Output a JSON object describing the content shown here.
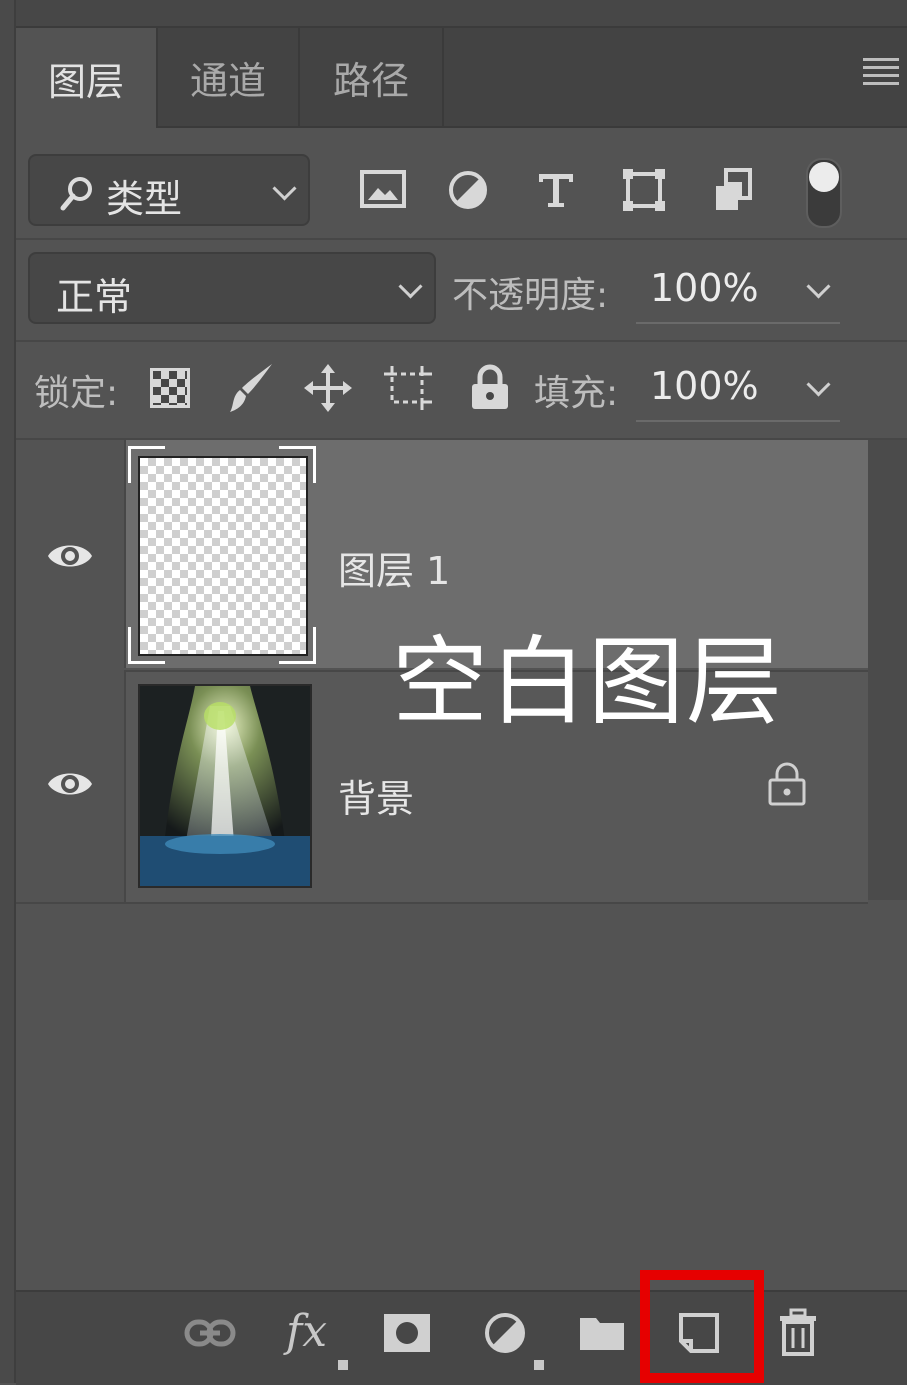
{
  "tabs": [
    {
      "label": "图层",
      "active": true
    },
    {
      "label": "通道",
      "active": false
    },
    {
      "label": "路径",
      "active": false
    }
  ],
  "filter": {
    "kind_label": "类型",
    "icons": [
      "image-filter-icon",
      "adjustment-filter-icon",
      "text-filter-icon",
      "shape-filter-icon",
      "smart-object-filter-icon",
      "filter-toggle-switch"
    ]
  },
  "blend": {
    "mode": "正常",
    "opacity_label": "不透明度:",
    "opacity_value": "100%"
  },
  "lock": {
    "label": "锁定:",
    "fill_label": "填充:",
    "fill_value": "100%",
    "icons": [
      "lock-transparent-icon",
      "lock-paint-icon",
      "lock-position-icon",
      "lock-artboard-icon",
      "lock-all-icon"
    ]
  },
  "layers": [
    {
      "name": "图层 1",
      "selected": true,
      "visible": true,
      "locked": false,
      "thumbnail": "transparent"
    },
    {
      "name": "背景",
      "selected": false,
      "visible": true,
      "locked": true,
      "thumbnail": "cave-waterfall-photo"
    }
  ],
  "annotation": {
    "text": "空白图层",
    "color": "#ffffff"
  },
  "bottom_toolbar": {
    "icons": [
      "link-layers-icon",
      "fx-icon",
      "layer-mask-icon",
      "adjustment-layer-icon",
      "group-folder-icon",
      "new-layer-icon",
      "trash-icon"
    ],
    "fx_text": "fx",
    "highlighted": "new-layer-icon",
    "highlight_color": "#e60000"
  },
  "colors": {
    "panel_bg": "#535353",
    "selected_row": "#6d6d6d"
  }
}
